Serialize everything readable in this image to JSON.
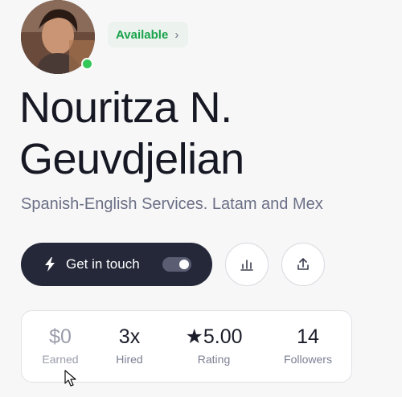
{
  "profile": {
    "name_line1": "Nouritza N.",
    "name_line2": "Geuvdjelian",
    "tagline": "Spanish-English Services. Latam and Mex",
    "status": {
      "label": "Available",
      "chevron": "›",
      "color": "#19a34b"
    }
  },
  "actions": {
    "primary_label": "Get in touch",
    "primary_icon": "bolt-icon",
    "toggle_on": true,
    "stats_icon": "bar-chart-icon",
    "share_icon": "share-icon"
  },
  "stats": [
    {
      "value": "$0",
      "label": "Earned"
    },
    {
      "value": "3x",
      "label": "Hired"
    },
    {
      "value": "★5.00",
      "label": "Rating"
    },
    {
      "value": "14",
      "label": "Followers"
    }
  ],
  "colors": {
    "accent_dark": "#252839",
    "online": "#34c759",
    "text_muted": "#6b6f85"
  }
}
